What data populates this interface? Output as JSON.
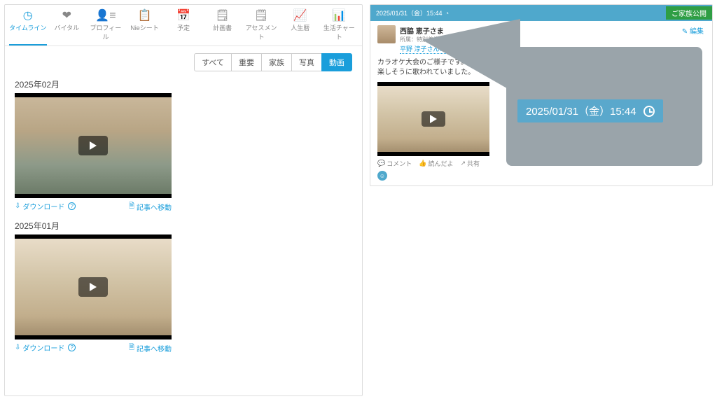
{
  "nav": [
    {
      "icon": "◷",
      "label": "タイムライン",
      "active": true
    },
    {
      "icon": "❤",
      "label": "バイタル"
    },
    {
      "icon": "👤≡",
      "label": "プロフィール"
    },
    {
      "icon": "📋",
      "label": "Nieシート"
    },
    {
      "icon": "📅",
      "label": "予定"
    },
    {
      "icon": "🗒",
      "label": "計画書"
    },
    {
      "icon": "🗒",
      "label": "アセスメント"
    },
    {
      "icon": "📈",
      "label": "人生暦"
    },
    {
      "icon": "📊",
      "label": "生活チャート"
    }
  ],
  "filters": [
    {
      "label": "すべて"
    },
    {
      "label": "重要"
    },
    {
      "label": "家族"
    },
    {
      "label": "写真"
    },
    {
      "label": "動画",
      "active": true
    }
  ],
  "months": [
    {
      "title": "2025年02月",
      "scene": "a",
      "download": "ダウンロード",
      "jump": "記事へ移動"
    },
    {
      "title": "2025年01月",
      "scene": "b",
      "download": "ダウンロード",
      "jump": "記事へ移動"
    }
  ],
  "post": {
    "datetime_small": "2025/01/31（金）15:44",
    "publish": "ご家族公開",
    "edit": "✎ 編集",
    "name": "西脇 恵子さま",
    "facility": "所属：特別養護老人ホーム けやき",
    "poster": "平野 淳子さんの投稿",
    "body_l1": "カラオケ大会のご様子です。",
    "body_l2": "楽しそうに歌われていました。",
    "actions": {
      "comment": "コメント",
      "like": "読んだよ",
      "share": "共有"
    }
  },
  "callout": {
    "text": "2025/01/31（金）15:44"
  }
}
